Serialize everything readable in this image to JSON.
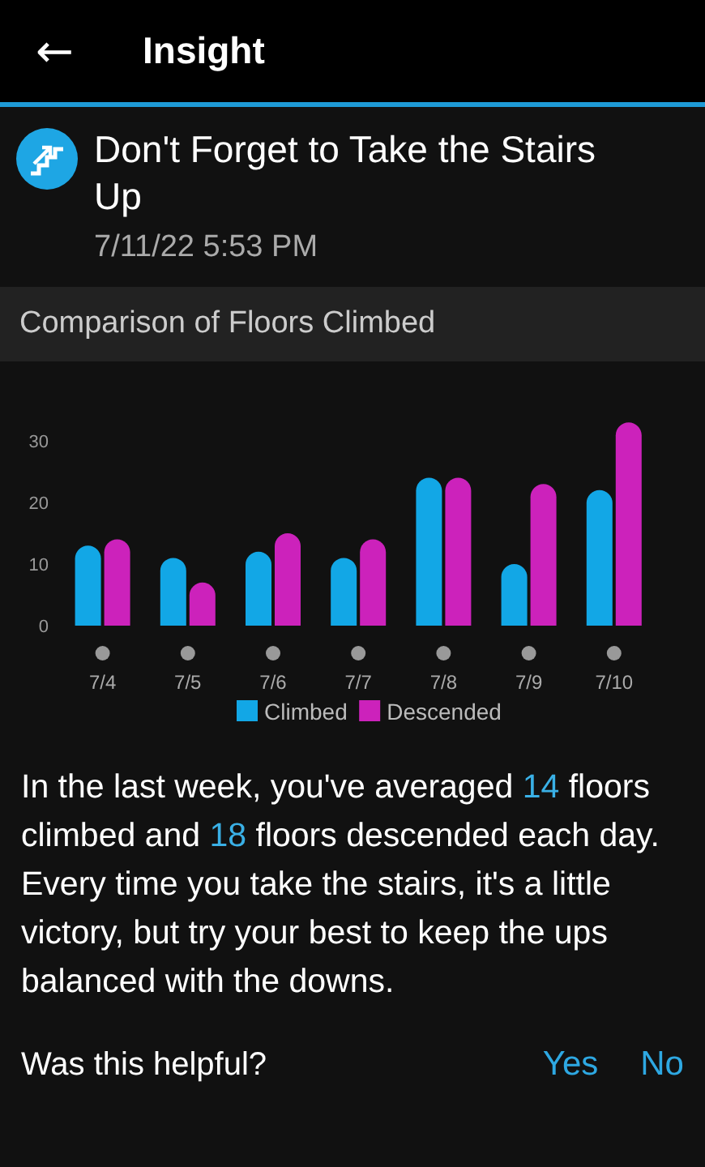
{
  "app_bar": {
    "back": "←",
    "title": "Insight"
  },
  "insight": {
    "title": "Don't Forget to Take the Stairs Up",
    "timestamp": "7/11/22 5:53 PM"
  },
  "section": {
    "title": "Comparison of Floors Climbed",
    "chart_data": {
      "type": "bar",
      "legend": true,
      "categories": [
        "7/4",
        "7/5",
        "7/6",
        "7/7",
        "7/8",
        "7/9",
        "7/10"
      ],
      "ylim": [
        0,
        33
      ],
      "yticks": [
        0,
        10,
        20,
        30
      ],
      "series": [
        {
          "name": "Climbed",
          "color": "#12a7e6",
          "values": [
            13,
            11,
            12,
            11,
            24,
            10,
            22
          ]
        },
        {
          "name": "Descended",
          "color": "#cc22bb",
          "values": [
            14,
            7,
            15,
            14,
            24,
            23,
            33
          ]
        }
      ]
    }
  },
  "message": [
    {
      "text": "In the last week, you've averaged ",
      "highlight": false
    },
    {
      "text": "14",
      "highlight": true
    },
    {
      "text": " floors climbed and ",
      "highlight": false
    },
    {
      "text": "18",
      "highlight": true
    },
    {
      "text": " floors descended each day. Every time you take the stairs, it's a little victory, but try your best to keep the ups balanced with the downs.",
      "highlight": false
    }
  ],
  "feedback": {
    "question": "Was this helpful?",
    "buttons": [
      "Yes",
      "No"
    ]
  }
}
